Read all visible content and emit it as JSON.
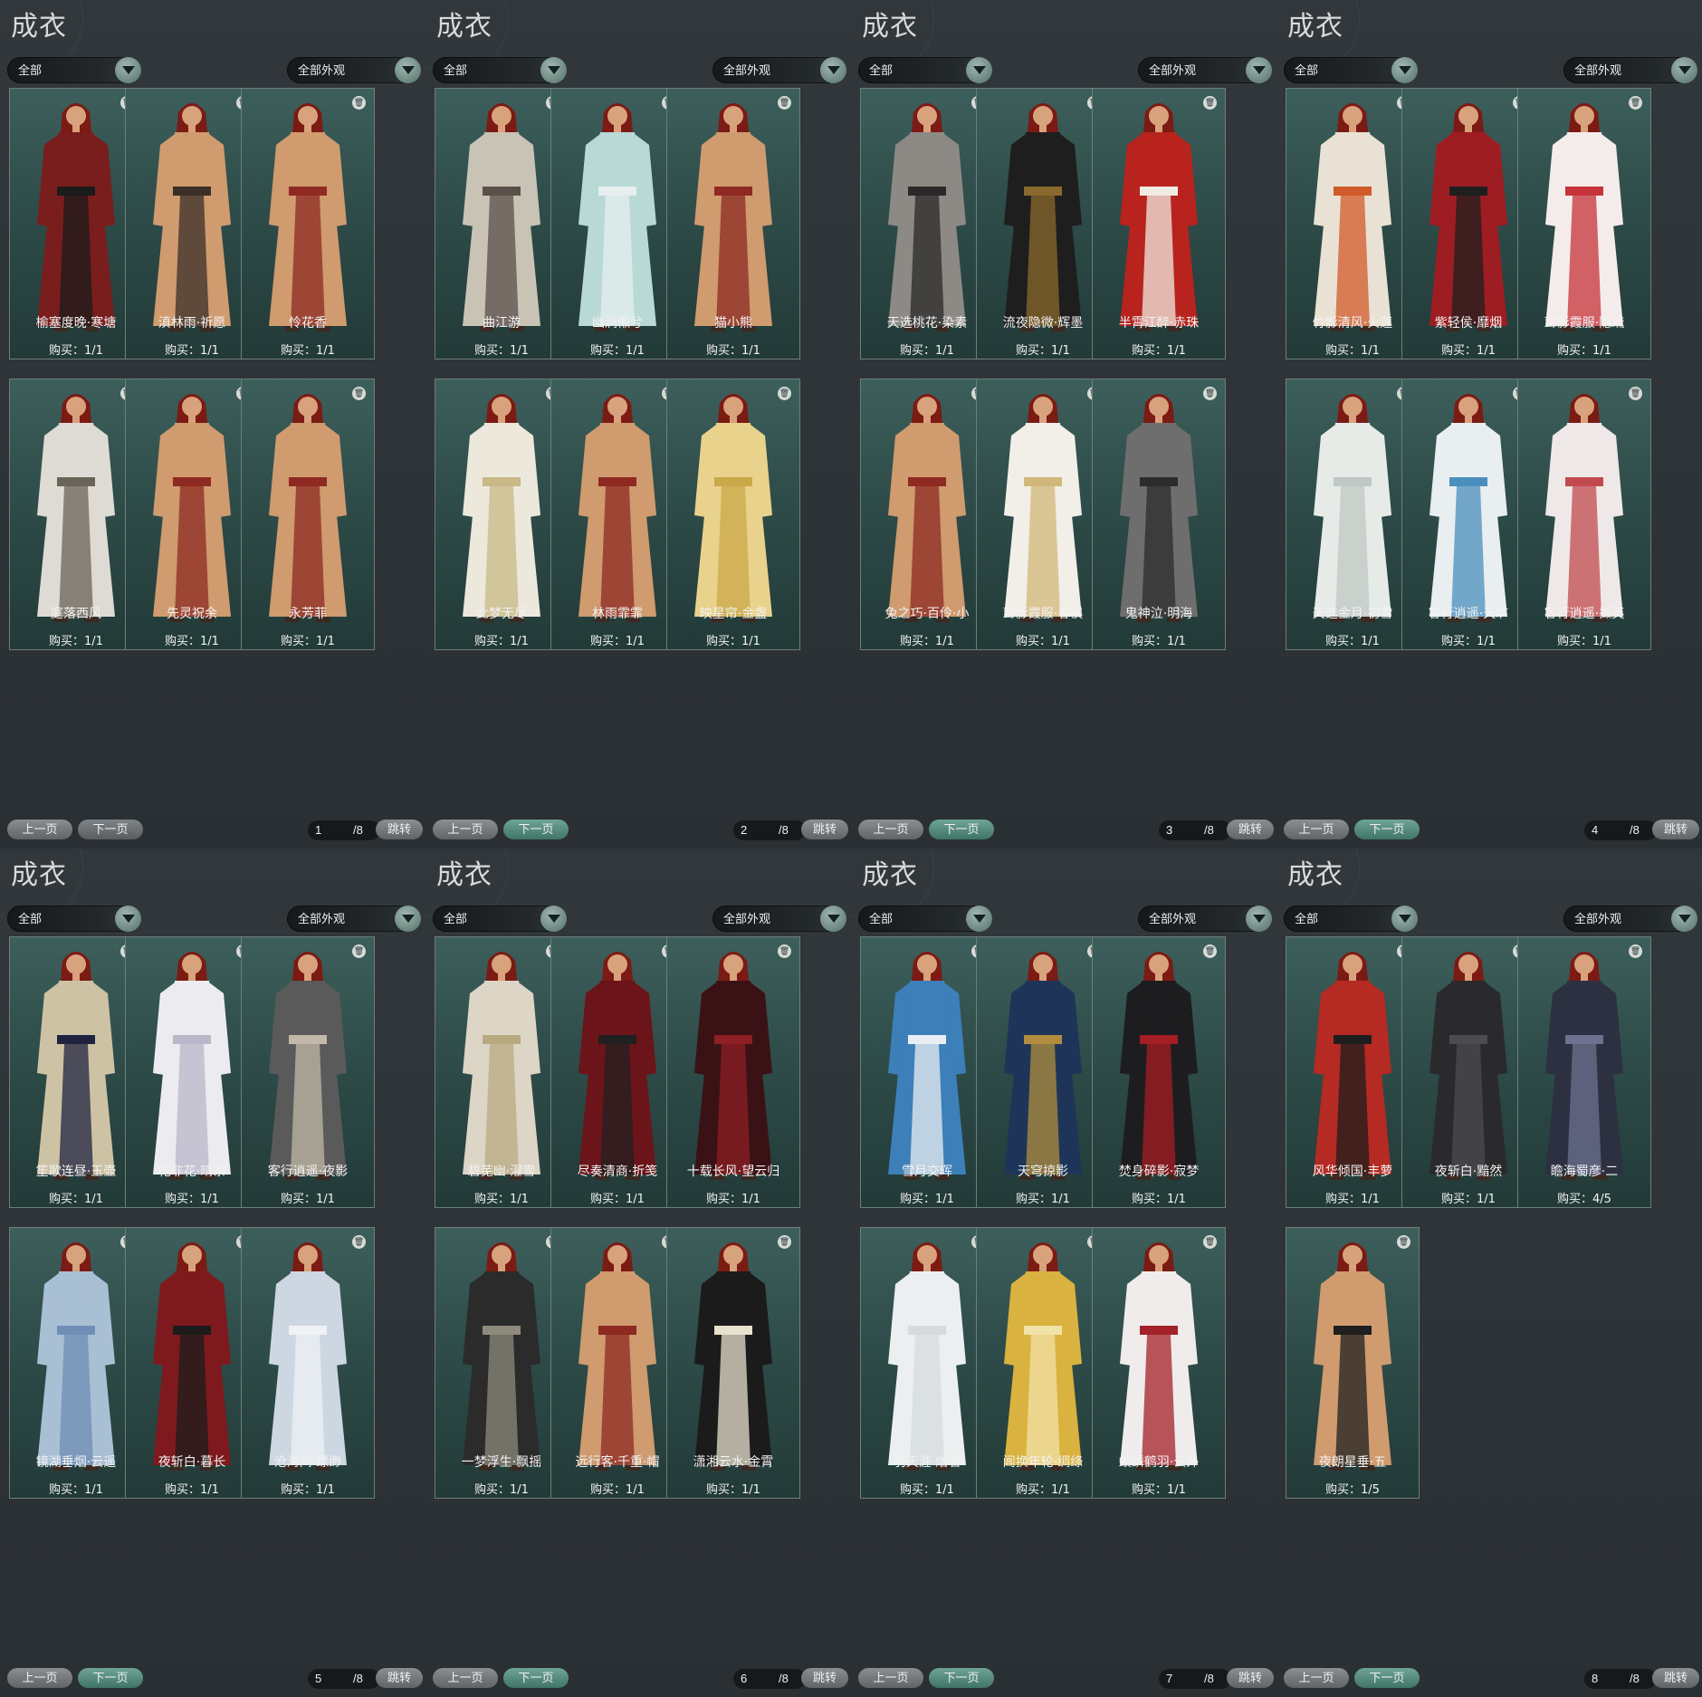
{
  "panels": [
    {
      "title": "成衣",
      "filter_left": "全部",
      "filter_right": "全部外观",
      "cards": [
        {
          "name": "榆塞度晚·寒塘",
          "buy": "购买：1/1",
          "outfit": "#7a1d1d",
          "accent": "#1b1b1b"
        },
        {
          "name": "滇林雨·祈愿",
          "buy": "购买：1/1",
          "outfit": "#cf9b6f",
          "accent": "#3a2e28"
        },
        {
          "name": "怜花香",
          "buy": "购买：1/1",
          "outfit": "#cf9b6f",
          "accent": "#8e2a22"
        },
        {
          "name": "庭落西风",
          "buy": "购买：1/1",
          "outfit": "#dedbd4",
          "accent": "#6a6358"
        },
        {
          "name": "先灵祝余",
          "buy": "购买：1/1",
          "outfit": "#cf9b6f",
          "accent": "#8e2a22"
        },
        {
          "name": "永芳菲",
          "buy": "购买：1/1",
          "outfit": "#cf9b6f",
          "accent": "#8e2a22"
        }
      ],
      "pager": {
        "prev": "上一页",
        "next": "下一页",
        "page": "1",
        "total": "/8",
        "jump": "跳转"
      }
    },
    {
      "title": "成衣",
      "filter_left": "全部",
      "filter_right": "全部外观",
      "cards": [
        {
          "name": "曲江游",
          "buy": "购买：1/1",
          "outfit": "#c9c3b6",
          "accent": "#5b4f4a"
        },
        {
          "name": "幽涧愀兮",
          "buy": "购买：1/1",
          "outfit": "#b9d9d6",
          "accent": "#e6efee"
        },
        {
          "name": "猫小熊",
          "buy": "购买：1/1",
          "outfit": "#cf9b6f",
          "accent": "#8e2a22"
        },
        {
          "name": "此梦无尽",
          "buy": "购买：1/1",
          "outfit": "#ece8dc",
          "accent": "#c8b987"
        },
        {
          "name": "林雨霏霏",
          "buy": "购买：1/1",
          "outfit": "#cf9b6f",
          "accent": "#8e2a22"
        },
        {
          "name": "映星帘·金盏",
          "buy": "购买：1/1",
          "outfit": "#e9d28c",
          "accent": "#c9a84a"
        }
      ],
      "pager": {
        "prev": "上一页",
        "next": "下一页",
        "page": "2",
        "total": "/8",
        "jump": "跳转"
      }
    },
    {
      "title": "成衣",
      "filter_left": "全部",
      "filter_right": "全部外观",
      "cards": [
        {
          "name": "天选桃花·染素",
          "buy": "购买：1/1",
          "outfit": "#8d8a86",
          "accent": "#2a2828"
        },
        {
          "name": "流夜隐微·辉墨",
          "buy": "购买：1/1",
          "outfit": "#1e1e1e",
          "accent": "#8a6a2c"
        },
        {
          "name": "半霄江醉·赤珠",
          "buy": "购买：1/1",
          "outfit": "#b8231e",
          "accent": "#f0ebe2"
        },
        {
          "name": "兔之巧·百伶·小",
          "buy": "购买：1/1",
          "outfit": "#cf9b6f",
          "accent": "#8e2a22"
        },
        {
          "name": "茸影霞服·春俣",
          "buy": "购买：1/1",
          "outfit": "#f2efe8",
          "accent": "#d1b77a"
        },
        {
          "name": "鬼神泣·明海",
          "buy": "购买：1/1",
          "outfit": "#6e6e6e",
          "accent": "#2c2c2c"
        }
      ],
      "pager": {
        "prev": "上一页",
        "next": "下一页",
        "page": "3",
        "total": "/8",
        "jump": "跳转"
      }
    },
    {
      "title": "成衣",
      "filter_left": "全部",
      "filter_right": "全部外观",
      "cards": [
        {
          "name": "竹影清风·火莲",
          "buy": "购买：1/1",
          "outfit": "#e9e1d3",
          "accent": "#d05a2a"
        },
        {
          "name": "紫轻侯·靡烟",
          "buy": "购买：1/1",
          "outfit": "#9e1d22",
          "accent": "#1f1f1f"
        },
        {
          "name": "茸影霞服·隐疏",
          "buy": "购买：1/1",
          "outfit": "#f4ecea",
          "accent": "#c7333a"
        },
        {
          "name": "天选金月·初雪",
          "buy": "购买：1/1",
          "outfit": "#e7ebe8",
          "accent": "#bfc8c4"
        },
        {
          "name": "客行逍遥·天旷",
          "buy": "购买：1/1",
          "outfit": "#e9eef0",
          "accent": "#4b8fbe"
        },
        {
          "name": "客行逍遥·撷英",
          "buy": "购买：1/1",
          "outfit": "#eee9e8",
          "accent": "#c24a4e"
        }
      ],
      "pager": {
        "prev": "上一页",
        "next": "下一页",
        "page": "4",
        "total": "/8",
        "jump": "跳转"
      }
    },
    {
      "title": "成衣",
      "filter_left": "全部",
      "filter_right": "全部外观",
      "cards": [
        {
          "name": "笙歌连昼·玉壶",
          "buy": "购买：1/1",
          "outfit": "#cdc3a4",
          "accent": "#1f2340"
        },
        {
          "name": "花非花·晴茶",
          "buy": "购买：1/1",
          "outfit": "#ececf0",
          "accent": "#b9b7c9"
        },
        {
          "name": "客行逍遥·夜影",
          "buy": "购买：1/1",
          "outfit": "#5a5a5a",
          "accent": "#c2b9a8"
        },
        {
          "name": "镜湖垂烟·云遥",
          "buy": "购买：1/1",
          "outfit": "#a9bfd4",
          "accent": "#6f8eb5"
        },
        {
          "name": "夜斩白·暮长",
          "buy": "购买：1/1",
          "outfit": "#7e1a1d",
          "accent": "#1c1c1c"
        },
        {
          "name": "沧海间·缥缈",
          "buy": "购买：1/1",
          "outfit": "#cdd7e2",
          "accent": "#eef2f5"
        }
      ],
      "pager": {
        "prev": "上一页",
        "next": "下一页",
        "page": "5",
        "total": "/8",
        "jump": "跳转"
      }
    },
    {
      "title": "成衣",
      "filter_left": "全部",
      "filter_right": "全部外观",
      "cards": [
        {
          "name": "碧芜幽·濯雪",
          "buy": "购买：1/1",
          "outfit": "#ddd5c6",
          "accent": "#b8a981"
        },
        {
          "name": "尽奏清商·折笺",
          "buy": "购买：1/1",
          "outfit": "#6b1419",
          "accent": "#202020"
        },
        {
          "name": "十载长风·望云归",
          "buy": "购买：1/1",
          "outfit": "#3a1215",
          "accent": "#8e1f24"
        },
        {
          "name": "一梦浮生·飘摇",
          "buy": "购买：1/1",
          "outfit": "#2b2b2b",
          "accent": "#8e8a7c"
        },
        {
          "name": "远行客·千重·帽",
          "buy": "购买：1/1",
          "outfit": "#cf9b6f",
          "accent": "#8e2a22"
        },
        {
          "name": "潇湘云水·金霄",
          "buy": "购买：1/1",
          "outfit": "#1b1b1b",
          "accent": "#e8e1cf"
        }
      ],
      "pager": {
        "prev": "上一页",
        "next": "下一页",
        "page": "6",
        "total": "/8",
        "jump": "跳转"
      }
    },
    {
      "title": "成衣",
      "filter_left": "全部",
      "filter_right": "全部外观",
      "cards": [
        {
          "name": "雪月交晖",
          "buy": "购买：1/1",
          "outfit": "#3d7fb8",
          "accent": "#e9eef2"
        },
        {
          "name": "天穹掠影",
          "buy": "购买：1/1",
          "outfit": "#1e3559",
          "accent": "#b08d3e"
        },
        {
          "name": "焚身碎影·寂梦",
          "buy": "购买：1/1",
          "outfit": "#1d1d1f",
          "accent": "#a51e24"
        },
        {
          "name": "羽天涯·熠若",
          "buy": "购买：1/1",
          "outfit": "#eceff0",
          "accent": "#d5dbdd"
        },
        {
          "name": "阊换年轮·绸绦",
          "buy": "购买：1/1",
          "outfit": "#d9b23f",
          "accent": "#f1e2a8"
        },
        {
          "name": "蛟鳞鹤羽·云外",
          "buy": "购买：1/1",
          "outfit": "#efeceb",
          "accent": "#a3222a"
        }
      ],
      "pager": {
        "prev": "上一页",
        "next": "下一页",
        "page": "7",
        "total": "/8",
        "jump": "跳转"
      }
    },
    {
      "title": "成衣",
      "filter_left": "全部",
      "filter_right": "全部外观",
      "cards": [
        {
          "name": "风华倾国·丰萝",
          "buy": "购买：1/1",
          "outfit": "#b52a22",
          "accent": "#1e1e1e"
        },
        {
          "name": "夜斩白·黯然",
          "buy": "购买：1/1",
          "outfit": "#2a2a2c",
          "accent": "#4b4b50"
        },
        {
          "name": "瞻海蜀彦·二",
          "buy": "购买：4/5",
          "outfit": "#2c3040",
          "accent": "#6c7290"
        },
        {
          "name": "夜朗星垂·五",
          "buy": "购买：1/5",
          "outfit": "#cf9b6f",
          "accent": "#1f1f1f"
        }
      ],
      "pager": {
        "prev": "上一页",
        "next": "下一页",
        "page": "8",
        "total": "/8",
        "jump": "跳转"
      }
    }
  ],
  "colors": {
    "hair": "#7c1a14",
    "skin": "#d8a27c",
    "panel_bg": "#2c3135",
    "card_bg": "#2e4c49",
    "card_border": "#6f7e78",
    "accent_teal": "#5d8f83"
  },
  "icons": {
    "delete": "trash-icon",
    "dropdown": "chevron-down-icon"
  }
}
